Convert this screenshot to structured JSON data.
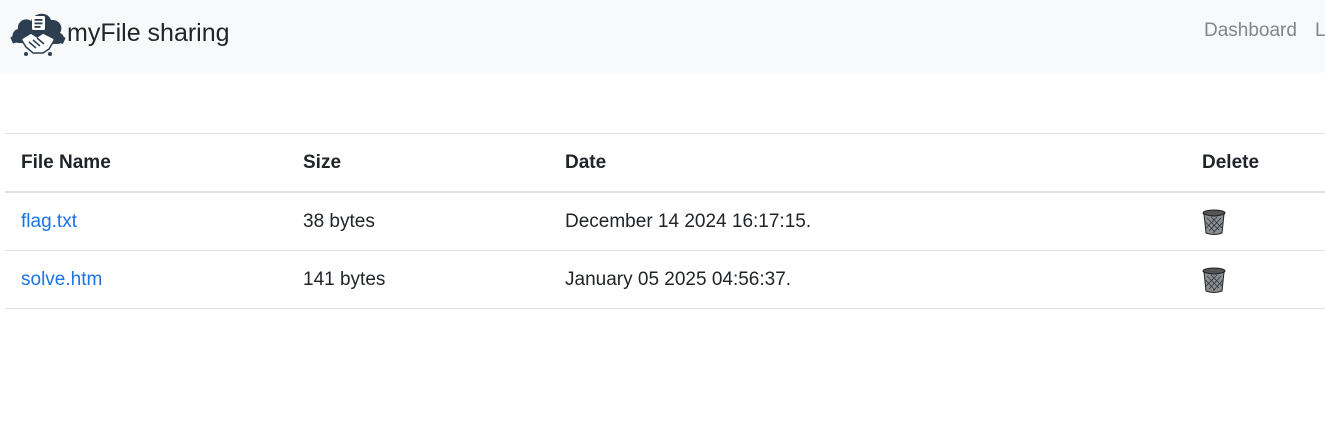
{
  "navbar": {
    "brand": "myFile sharing",
    "logo_icon": "cloud-handshake-icon",
    "links": [
      "Dashboard",
      "L"
    ]
  },
  "table": {
    "headers": [
      "File Name",
      "Size",
      "Date",
      "Delete"
    ],
    "rows": [
      {
        "name": "flag.txt",
        "size": "38 bytes",
        "date": "December 14 2024 16:17:15.",
        "delete_icon": "trash-can-icon"
      },
      {
        "name": "solve.htm",
        "size": "141 bytes",
        "date": "January 05 2025 04:56:37.",
        "delete_icon": "trash-can-icon"
      }
    ]
  },
  "colors": {
    "navbar_bg": "#f8f9fa",
    "link": "#1a73e8",
    "nav_link": "#80868b",
    "text": "#212529"
  }
}
